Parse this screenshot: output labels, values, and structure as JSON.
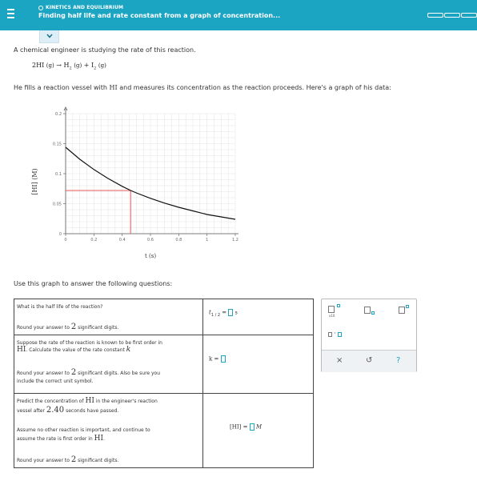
{
  "header": {
    "topic": "KINETICS AND EQUILIBRIUM",
    "title": "Finding half life and rate constant from a graph of concentration..."
  },
  "intro": "A chemical engineer is studying the rate of this reaction.",
  "reaction": {
    "lhs": "2HI",
    "arrow": "→",
    "rhs1": "H",
    "rhs1_sub": "2",
    "plus": "+",
    "rhs2": "I",
    "rhs2_sub": "2",
    "state": "(g)"
  },
  "intro2_a": "He fills a reaction vessel with ",
  "intro2_hi": "HI",
  "intro2_b": " and measures its concentration as the reaction proceeds. Here's a graph of his data:",
  "chart_data": {
    "type": "line",
    "xlabel": "t (s)",
    "ylabel": "[HI] (M)",
    "xlim": [
      0,
      1.2
    ],
    "ylim": [
      0,
      0.2
    ],
    "xticks": [
      "0",
      "0.2",
      "0.4",
      "0.6",
      "0.8",
      "1",
      "1.2"
    ],
    "yticks": [
      "0",
      "0.05",
      "0.1",
      "0.15",
      "0.2"
    ],
    "series": [
      {
        "x": [
          0,
          0.1,
          0.2,
          0.3,
          0.4,
          0.46,
          0.5,
          0.6,
          0.7,
          0.8,
          0.9,
          1.0,
          1.1,
          1.2
        ],
        "y": [
          0.144,
          0.124,
          0.107,
          0.092,
          0.079,
          0.072,
          0.068,
          0.059,
          0.051,
          0.044,
          0.038,
          0.032,
          0.028,
          0.024
        ]
      }
    ],
    "guide": {
      "x": 0.46,
      "y": 0.072,
      "color": "#e85a5a"
    },
    "grid": true
  },
  "prompt": "Use this graph to answer the following questions:",
  "q1": {
    "text": "What is the half life of the reaction?",
    "round": "Round your answer to",
    "round_num": "2",
    "round_tail": "significant digits.",
    "ans_t": "t",
    "ans_sub": "1 / 2",
    "ans_eq": "=",
    "ans_unit": "s"
  },
  "q2": {
    "text_a": "Suppose the rate of the reaction is known to be first order in",
    "hi": "HI",
    "text_b": ". Calculate the value of the rate constant",
    "k": "k",
    "round_a": "Round your answer to",
    "round_num": "2",
    "round_b": "significant digits. Also be sure you",
    "round_c": "include the correct unit symbol.",
    "ans_k": "k",
    "ans_eq": "="
  },
  "q3": {
    "text_a": "Predict the concentration of",
    "hi": "HI",
    "text_b": "in the engineer's reaction",
    "text_c_a": "vessel after",
    "time": "2.40",
    "text_c_b": "seconds have passed.",
    "assume_a": "Assume no other reaction is important, and continue to",
    "assume_b": "assume the rate is first order in",
    "round_a": "Round your answer to",
    "round_num": "2",
    "round_b": "significant digits.",
    "ans_lhs": "[HI]",
    "ans_eq": "=",
    "ans_unit": "M"
  },
  "tools": {
    "x10": "x10",
    "dot": "·",
    "clear": "×",
    "undo": "↺",
    "help": "?",
    "accent": "#1ba5c2"
  }
}
